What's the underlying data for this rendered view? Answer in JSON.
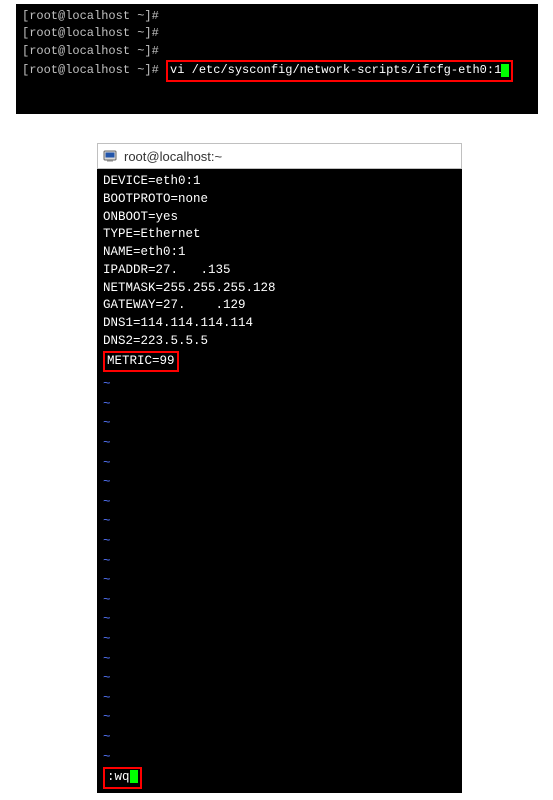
{
  "terminal_top": {
    "prompt": "[root@localhost ~]#",
    "command": "vi /etc/sysconfig/network-scripts/ifcfg-eth0:1"
  },
  "window": {
    "title": "root@localhost:~"
  },
  "editor": {
    "lines": {
      "device": "DEVICE=eth0:1",
      "bootproto": "BOOTPROTO=none",
      "onboot": "ONBOOT=yes",
      "type": "TYPE=Ethernet",
      "name": "NAME=eth0:1",
      "ipaddr_prefix": "IPADDR=27.",
      "ipaddr_suffix": ".135",
      "netmask_prefix": "NETMASK=255.",
      "netmask_mid": "255.",
      "netmask_suffix": "255.128",
      "gateway_prefix": "GATEWAY=27.",
      "gateway_suffix": ".129",
      "dns1": "DNS1=114.114.114.114",
      "dns2": "DNS2=223.5.5.5",
      "metric": "METRIC=99"
    },
    "tilde": "~",
    "command_prefix": ":",
    "command": "wq"
  }
}
